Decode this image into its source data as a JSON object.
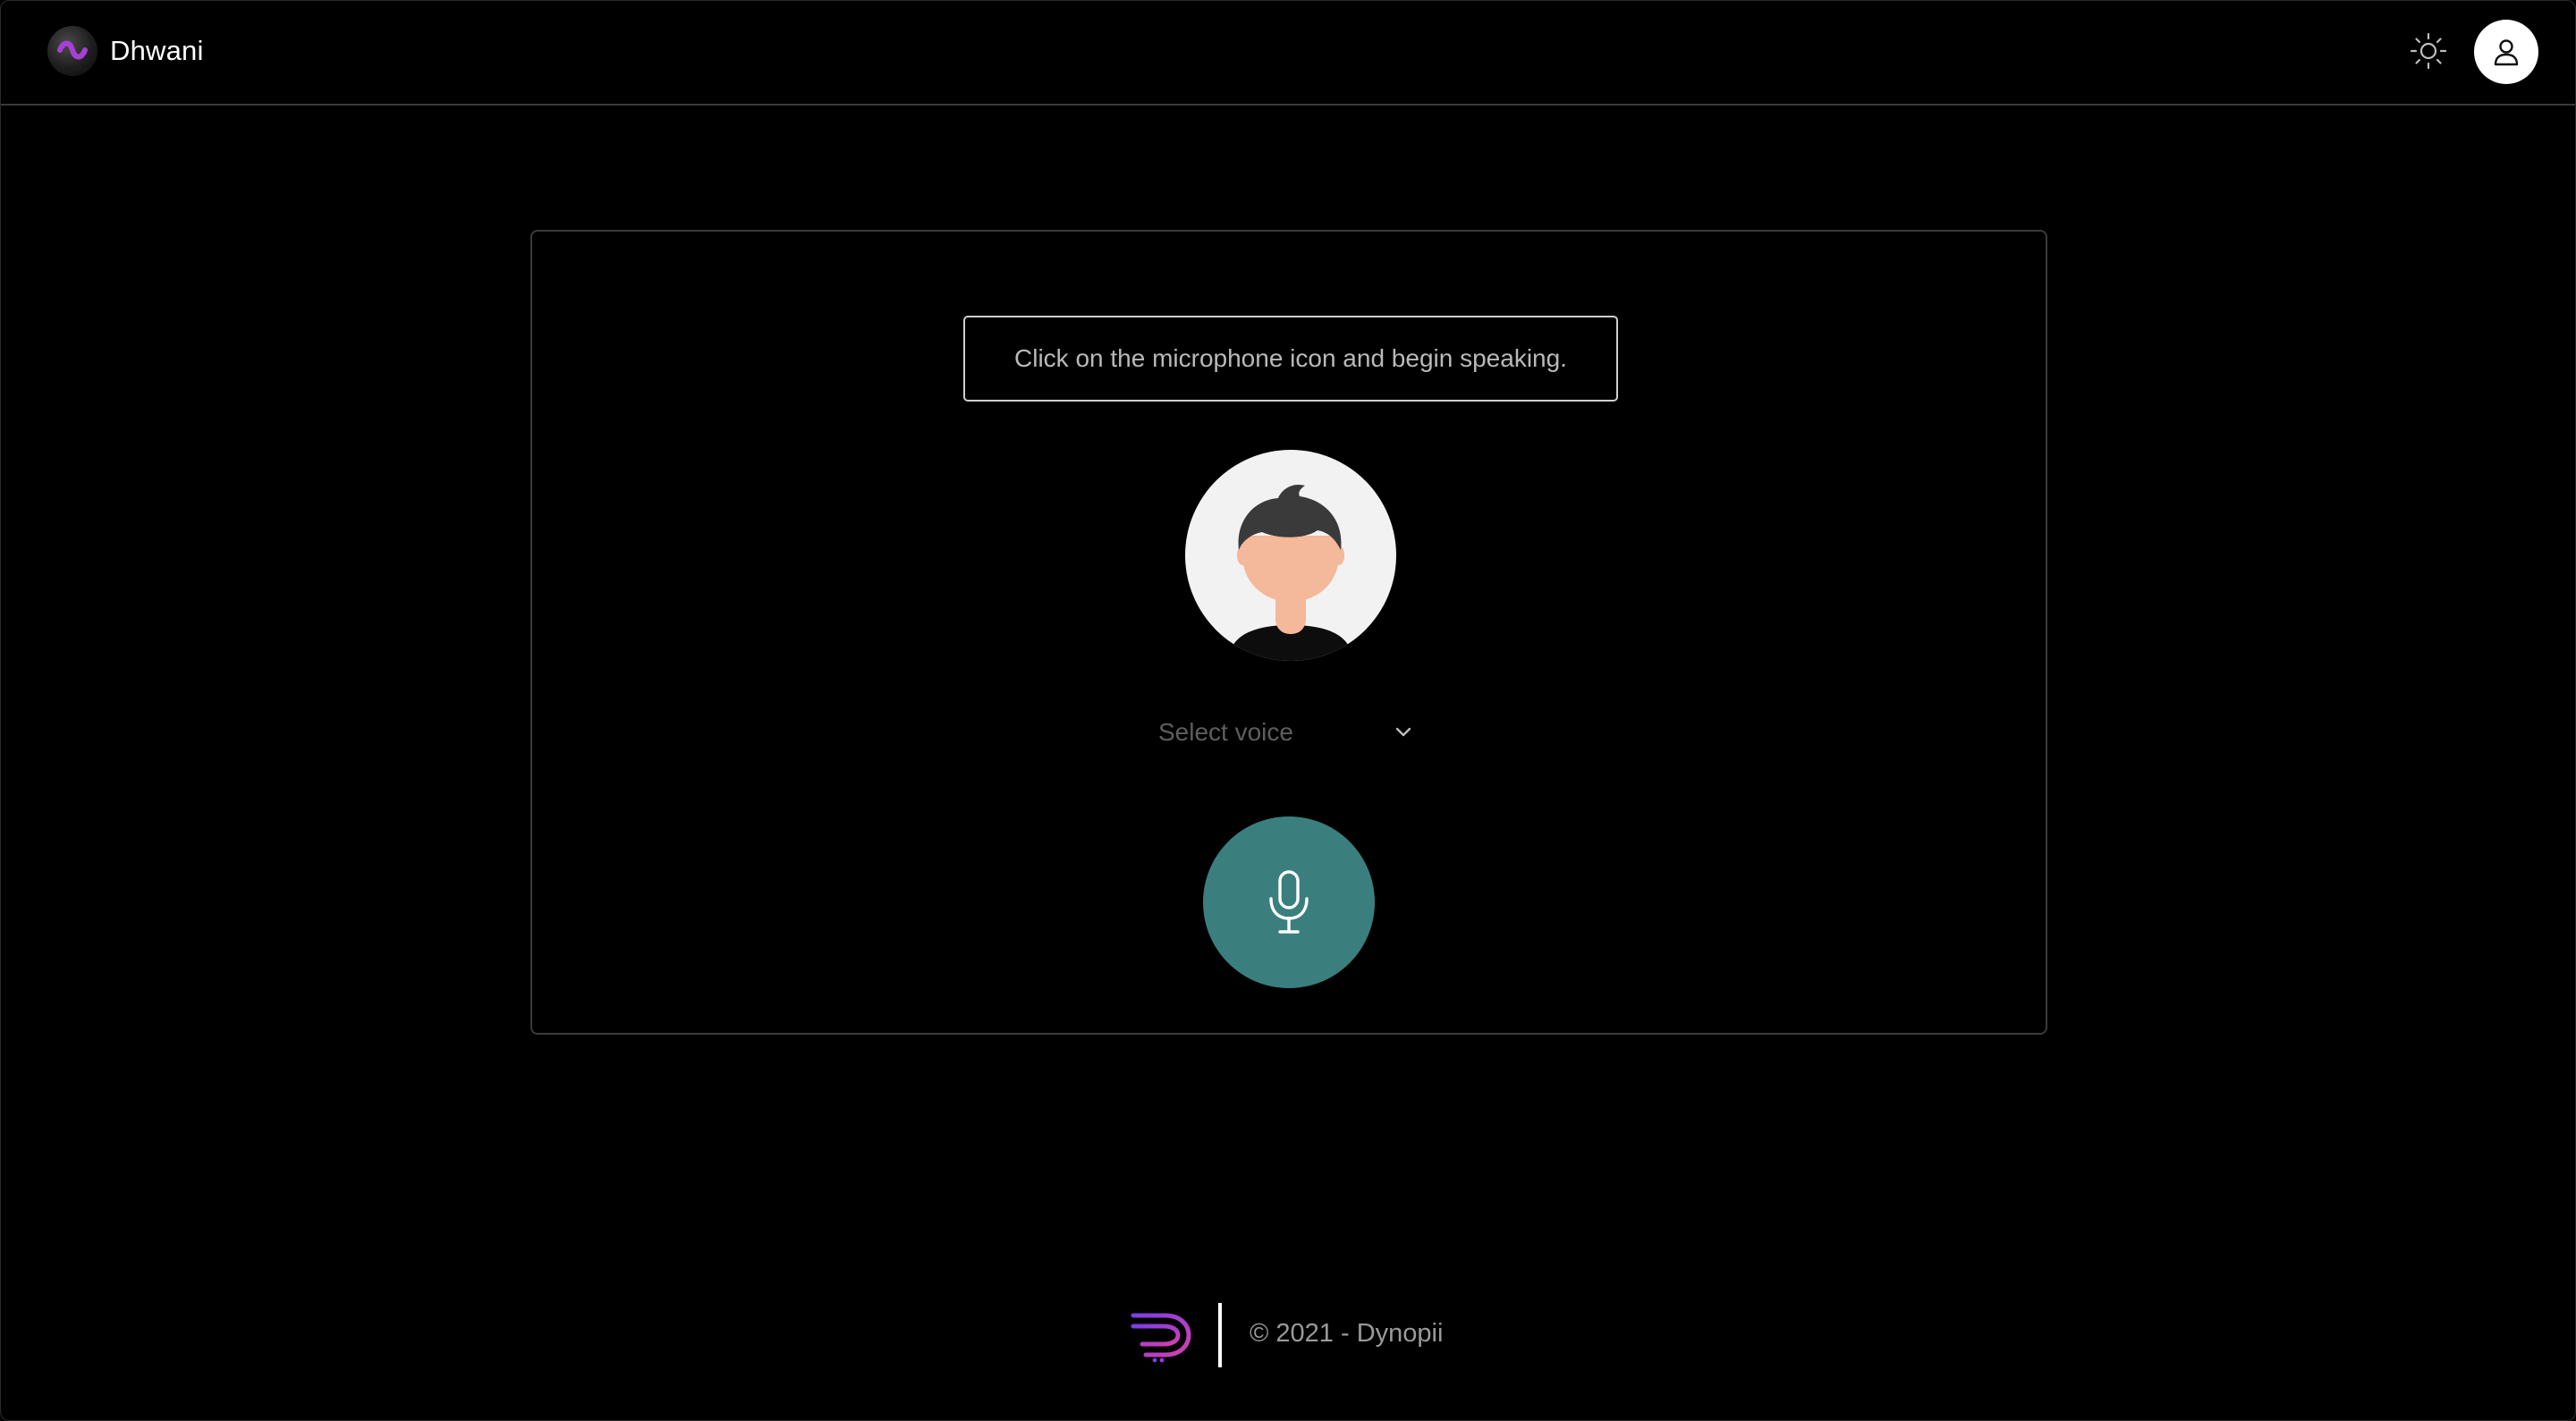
{
  "header": {
    "app_name": "Dhwani",
    "logo_icon": "dhwani-wave-logo",
    "theme_icon": "sun-icon",
    "user_icon": "user-icon"
  },
  "main": {
    "instruction": "Click on the microphone icon and begin speaking.",
    "avatar_icon": "person-avatar",
    "voice_select": {
      "placeholder": "Select voice",
      "icon": "chevron-down-icon"
    },
    "mic_icon": "microphone-icon",
    "mic_color": "#3a7f7e"
  },
  "footer": {
    "logo_icon": "dynopii-logo",
    "copyright": "© 2021 - Dynopii"
  },
  "colors": {
    "background": "#000000",
    "accent_purple": "#a63fd4",
    "border": "#3a3a3a"
  }
}
